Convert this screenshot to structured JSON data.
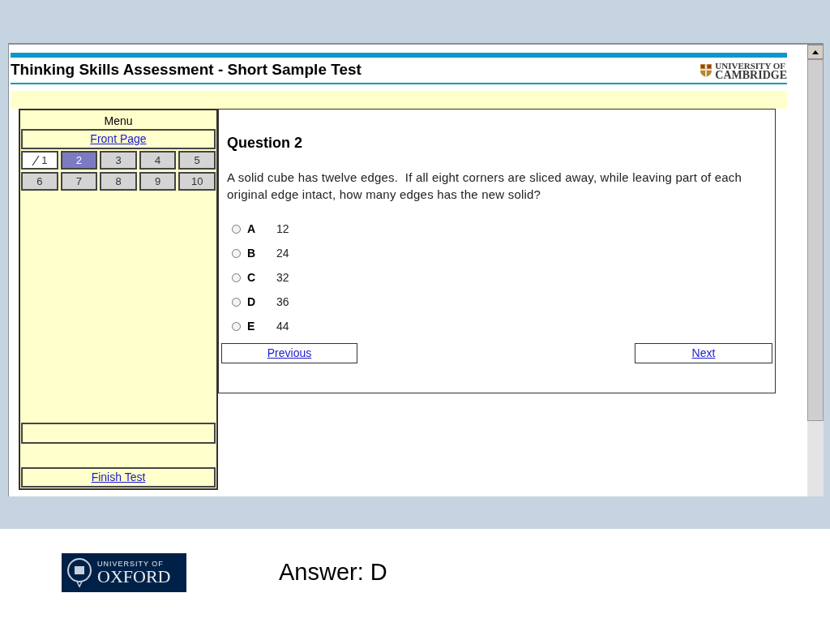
{
  "page": {
    "title": "Thinking Skills Assessment - Short Sample Test",
    "logo_line_1": "UNIVERSITY OF",
    "logo_line_2": "CAMBRIDGE"
  },
  "menu": {
    "title": "Menu",
    "front_page": "Front Page",
    "finish": "Finish Test",
    "questions": [
      {
        "label": "1",
        "selected": false,
        "answered": true
      },
      {
        "label": "2",
        "selected": true,
        "answered": false
      },
      {
        "label": "3",
        "selected": false,
        "answered": false
      },
      {
        "label": "4",
        "selected": false,
        "answered": false
      },
      {
        "label": "5",
        "selected": false,
        "answered": false
      },
      {
        "label": "6",
        "selected": false,
        "answered": false
      },
      {
        "label": "7",
        "selected": false,
        "answered": false
      },
      {
        "label": "8",
        "selected": false,
        "answered": false
      },
      {
        "label": "9",
        "selected": false,
        "answered": false
      },
      {
        "label": "10",
        "selected": false,
        "answered": false
      }
    ]
  },
  "question": {
    "heading": "Question 2",
    "text": "A solid cube has twelve edges.  If all eight corners are sliced away, while leaving part of each original edge intact, how many edges has the new solid?",
    "options": [
      {
        "letter": "A",
        "value": "12",
        "selected": false
      },
      {
        "letter": "B",
        "value": "24",
        "selected": false
      },
      {
        "letter": "C",
        "value": "32",
        "selected": false
      },
      {
        "letter": "D",
        "value": "36",
        "selected": false
      },
      {
        "letter": "E",
        "value": "44",
        "selected": false
      }
    ],
    "previous": "Previous",
    "next": "Next"
  },
  "slide": {
    "logo_line_1": "UNIVERSITY OF",
    "logo_line_2": "OXFORD",
    "answer": "Answer: D"
  }
}
